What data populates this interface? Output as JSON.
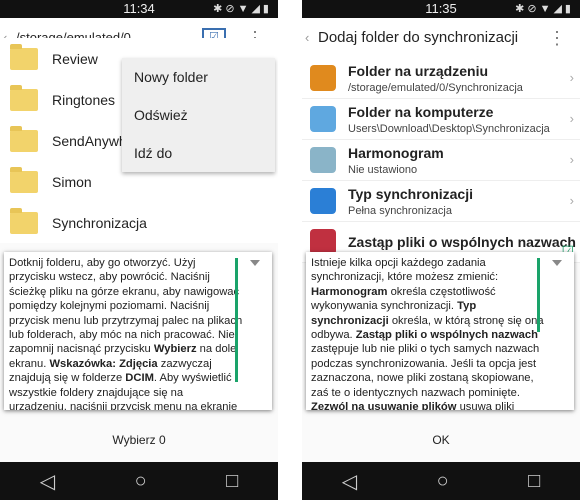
{
  "left": {
    "status_time": "11:34",
    "path": "/storage/emulated/0",
    "folders": [
      "Review",
      "Ringtones",
      "SendAnywhere",
      "Simon",
      "Synchronizacja"
    ],
    "menu": [
      "Nowy folder",
      "Odśwież",
      "Idź do"
    ],
    "help_html": "Dotknij folderu, aby go otworzyć. Użyj przycisku wstecz, aby powrócić. Naciśnij ścieżkę pliku na górze ekranu, aby nawigować pomiędzy kolejnymi poziomami. Naciśnij przycisk menu lub przytrzymaj palec na plikach lub folderach, aby móc na nich pracować. Nie zapomnij nacisnąć przycisku <b>Wybierz</b> na dole ekranu. <b>Wskazówka: Zdjęcia</b> zazwyczaj znajdują się w folderze <b>DCIM</b>. Aby wyświetlić wszystkie foldery znajdujące się na urządzeniu, naciśnij przycisk menu na ekranie głównym, wejdź do ustawień i wybierz opcję \"Pokaż wszystkie foldery\".",
    "button": "Wybierz 0"
  },
  "right": {
    "status_time": "11:35",
    "title": "Dodaj folder do synchronizacji",
    "items": [
      {
        "title": "Folder na urządzeniu",
        "sub": "/storage/emulated/0/Synchronizacja",
        "icon": "pda-icon",
        "color": "#e08a1e"
      },
      {
        "title": "Folder na komputerze",
        "sub": "Users\\Download\\Desktop\\Synchronizacja",
        "icon": "computer-icon",
        "color": "#5fa8e0"
      },
      {
        "title": "Harmonogram",
        "sub": "Nie ustawiono",
        "icon": "schedule-icon",
        "color": "#8ab4c8"
      },
      {
        "title": "Typ synchronizacji",
        "sub": "Pełna synchronizacja",
        "icon": "sync-arrows-icon",
        "color": "#2b7fd6"
      },
      {
        "title": "Zastąp pliki o wspólnych nazwach",
        "sub": "",
        "icon": "replace-files-icon",
        "color": "#c03040"
      }
    ],
    "help_html": "Istnieje kilka opcji każdego zadania synchronizacji, które możesz zmienić: <b>Harmonogram</b> określa częstotliwość wykonywania synchronizacji. <b>Typ synchronizacji</b> określa, w którą stronę się ona odbywa. <b>Zastąp pliki o wspólnych nazwach</b> zastępuje lub nie pliki o tych samych nazwach podczas synchronizowania. Jeśli ta opcja jest zaznaczona, nowe pliki zostaną skopiowane, zaś te o identycznych nazwach pominięte. <b>Zezwól na usuwanie plików</b> usuwa pliki usunięte",
    "button": "OK"
  },
  "accent": "#1aa36a"
}
